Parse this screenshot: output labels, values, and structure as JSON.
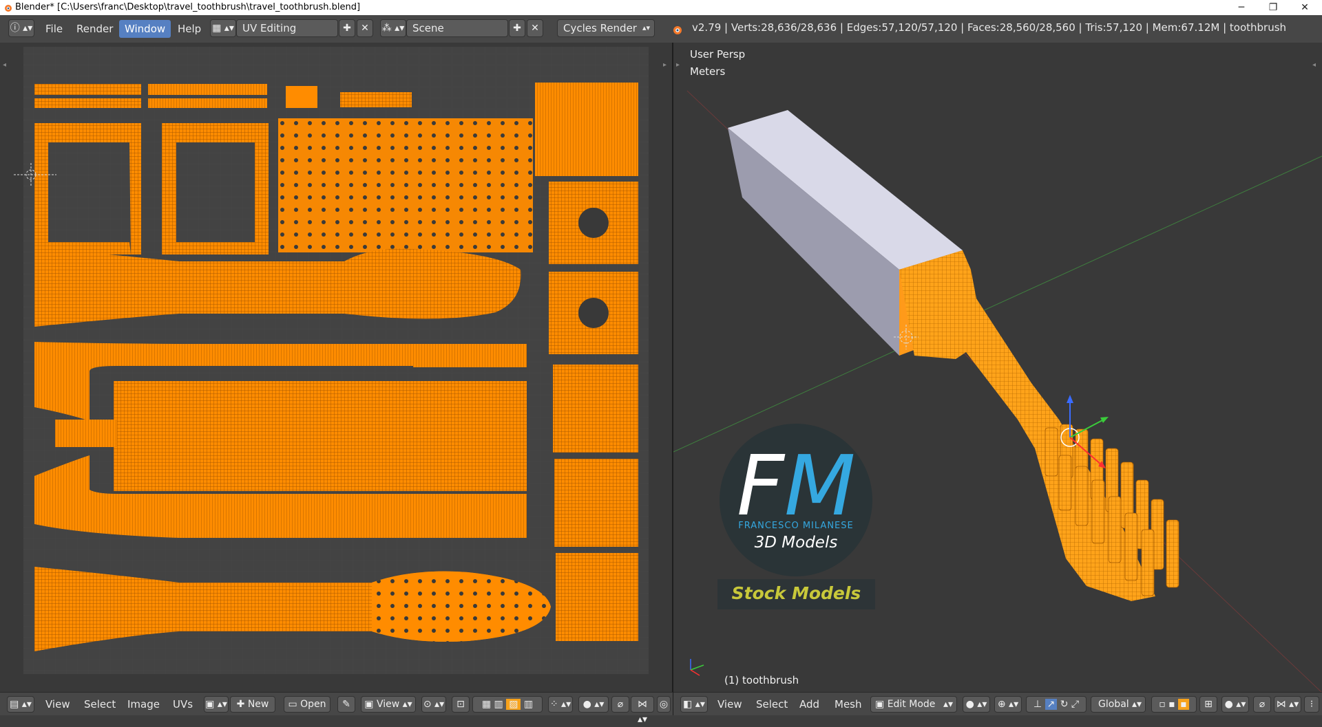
{
  "window": {
    "title": "Blender* [C:\\Users\\franc\\Desktop\\travel_toothbrush\\travel_toothbrush.blend]",
    "controls": [
      "─",
      "❐",
      "✕"
    ]
  },
  "menu": {
    "items": [
      "File",
      "Render",
      "Window",
      "Help"
    ],
    "active": "Window"
  },
  "screen_layout": "UV Editing",
  "scene": "Scene",
  "render_engine": "Cycles Render",
  "stats": "v2.79 | Verts:28,636/28,636 | Edges:57,120/57,120 | Faces:28,560/28,560 | Tris:57,120 | Mem:67.12M | toothbrush",
  "viewport": {
    "view_name": "User Persp",
    "units": "Meters",
    "object_label": "(1) toothbrush"
  },
  "logo": {
    "letter_f": "F",
    "letter_m": "M",
    "name": "FRANCESCO MILANESE",
    "tagline": "3D Models",
    "stock": "Stock Models"
  },
  "uv_bottom": {
    "items": [
      "View",
      "Select",
      "Image",
      "UVs"
    ],
    "new_label": "New",
    "open_label": "Open",
    "view_label": "View"
  },
  "view3d_bottom": {
    "items": [
      "View",
      "Select",
      "Add",
      "Mesh"
    ],
    "mode": "Edit Mode",
    "orientation": "Global"
  },
  "colors": {
    "uv_orange": "#ff8c00",
    "accent_blue": "#5680c2",
    "header_bg": "#474747",
    "panel_bg": "#393939",
    "handle_gray": "#c4c4d4"
  }
}
